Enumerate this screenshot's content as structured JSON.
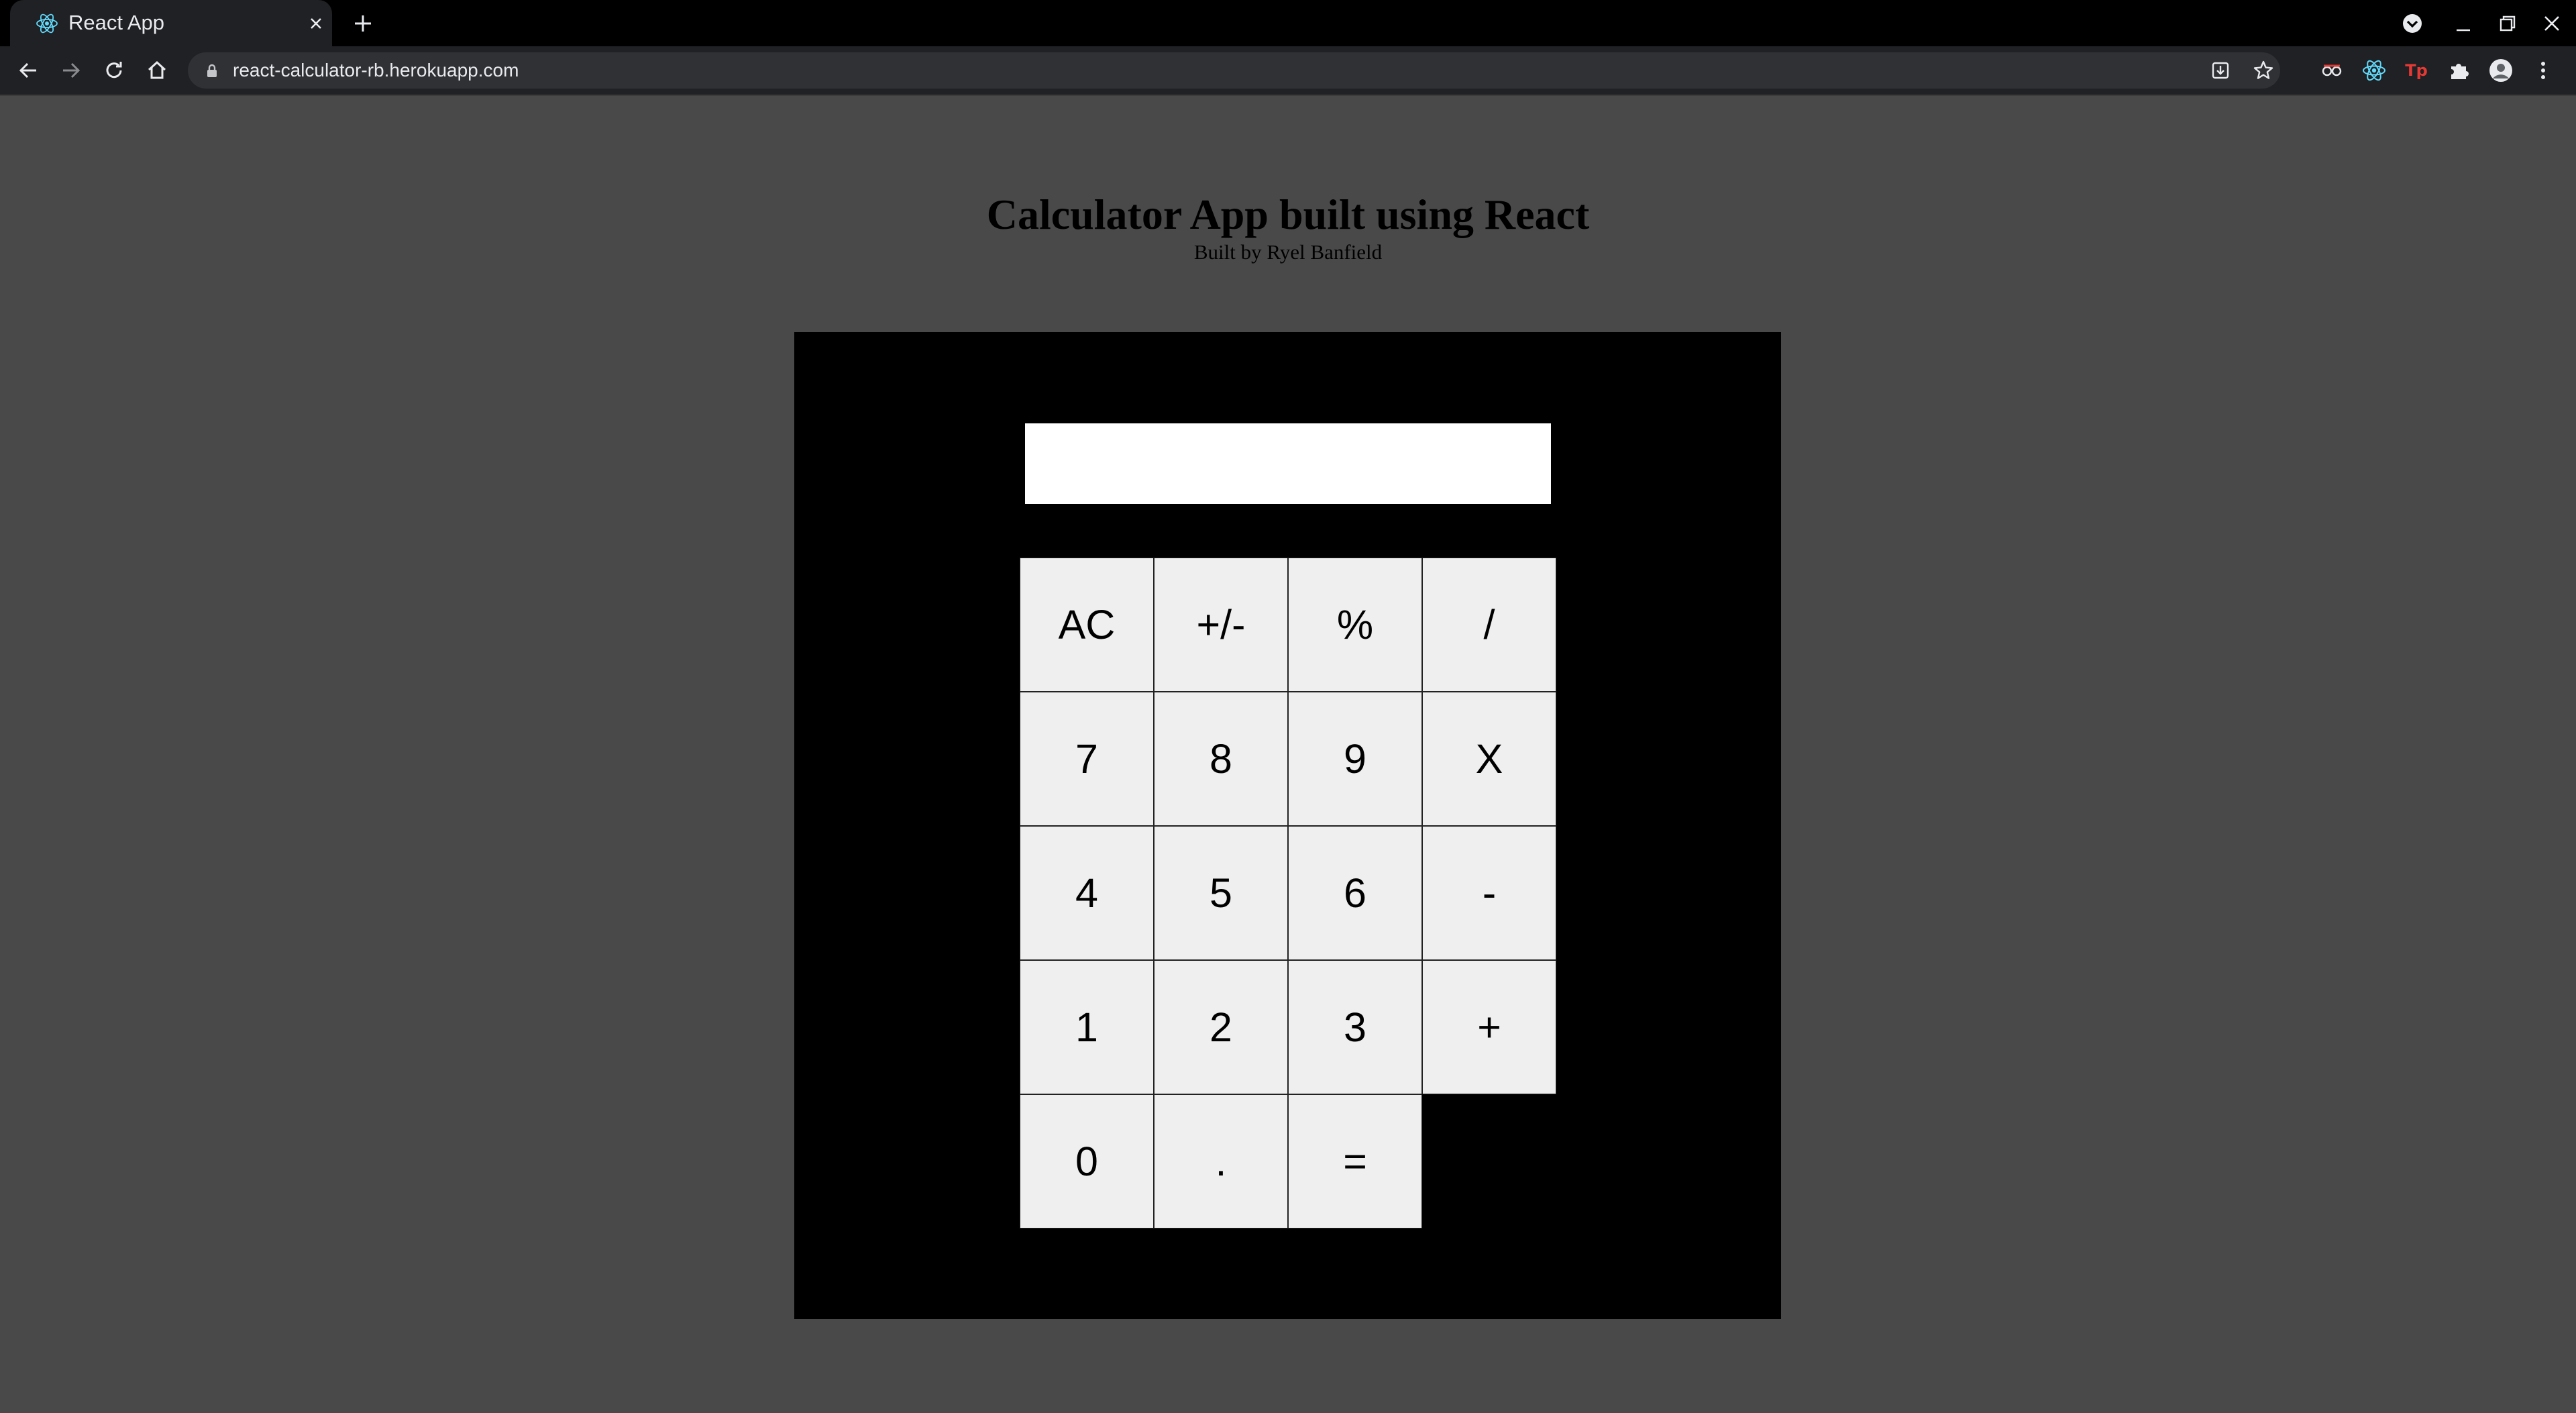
{
  "browser": {
    "tab_title": "React App",
    "url": "react-calculator-rb.herokuapp.com",
    "extensions": [
      {
        "name": "spy-glasses-extension-icon"
      },
      {
        "name": "react-devtools-extension-icon"
      },
      {
        "name": "tp-extension-icon",
        "label": "Tp"
      },
      {
        "name": "extensions-puzzle-icon"
      }
    ],
    "colors": {
      "tabstrip": "#000000",
      "toolbar": "#202124",
      "omnibox": "#303134",
      "react_blue": "#61dafb",
      "tp_red": "#e53935"
    }
  },
  "page": {
    "title": "Calculator App built using React",
    "subtitle": "Built by Ryel Banfield",
    "background": "#494949"
  },
  "calculator": {
    "display_value": "",
    "rows": [
      [
        "AC",
        "+/-",
        "%",
        "/"
      ],
      [
        "7",
        "8",
        "9",
        "X"
      ],
      [
        "4",
        "5",
        "6",
        "-"
      ],
      [
        "1",
        "2",
        "3",
        "+"
      ],
      [
        "0",
        ".",
        "="
      ]
    ],
    "colors": {
      "frame": "#000000",
      "display": "#ffffff",
      "key_background": "#efefef",
      "key_border": "#222222"
    }
  }
}
